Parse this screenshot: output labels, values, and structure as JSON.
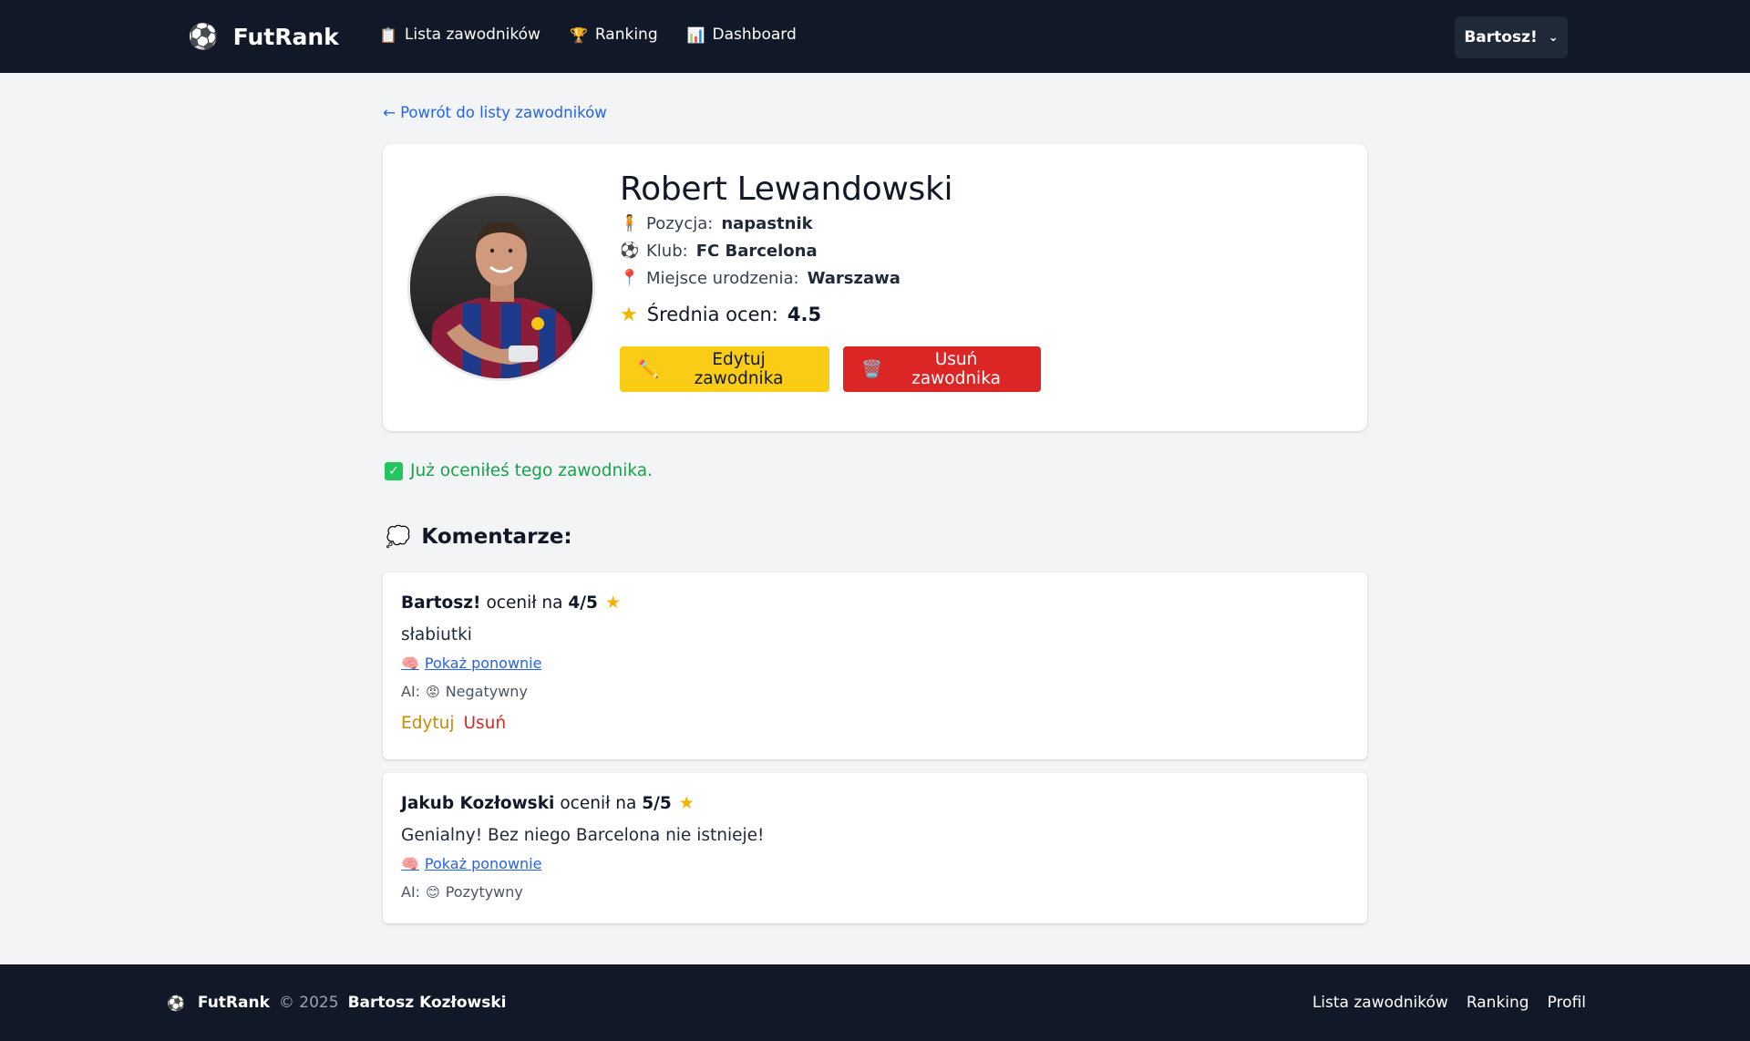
{
  "navbar": {
    "brand_icon": "soccer-ball-icon",
    "brand_name": "FutRank",
    "links": [
      {
        "icon": "clipboard-icon",
        "glyph": "📋",
        "label": "Lista zawodników"
      },
      {
        "icon": "trophy-icon",
        "glyph": "🏆",
        "label": "Ranking"
      },
      {
        "icon": "bar-chart-icon",
        "glyph": "📊",
        "label": "Dashboard"
      }
    ],
    "user_label": "Bartosz!"
  },
  "back_link": "← Powrót do listy zawodników",
  "player": {
    "name": "Robert Lewandowski",
    "position_label": "Pozycja:",
    "position_value": "napastnik",
    "club_label": "Klub:",
    "club_value": "FC Barcelona",
    "birthplace_label": "Miejsce urodzenia:",
    "birthplace_value": "Warszawa",
    "avg_label": "Średnia ocen:",
    "avg_value": "4.5",
    "edit_button": "Edytuj zawodnika",
    "delete_button": "Usuń zawodnika"
  },
  "rated_notice": "Już oceniłeś tego zawodnika.",
  "comments_title": "Komentarze:",
  "comments": [
    {
      "author": "Bartosz!",
      "rated_on": "ocenił na",
      "rating": "4/5",
      "text": "słabiutki",
      "show_again": "Pokaż ponownie",
      "ai_label": "AI:",
      "ai_emoji": "😡",
      "sentiment": "Negatywny",
      "edit_label": "Edytuj",
      "delete_label": "Usuń"
    },
    {
      "author": "Jakub Kozłowski",
      "rated_on": "ocenił na",
      "rating": "5/5",
      "text": "Genialny! Bez niego Barcelona nie istnieje!",
      "show_again": "Pokaż ponownie",
      "ai_label": "AI:",
      "ai_emoji": "😊",
      "sentiment": "Pozytywny"
    }
  ],
  "footer": {
    "brand": "FutRank",
    "copyright": "© 2025",
    "author": "Bartosz Kozłowski",
    "links": [
      "Lista zawodników",
      "Ranking",
      "Profil"
    ]
  }
}
